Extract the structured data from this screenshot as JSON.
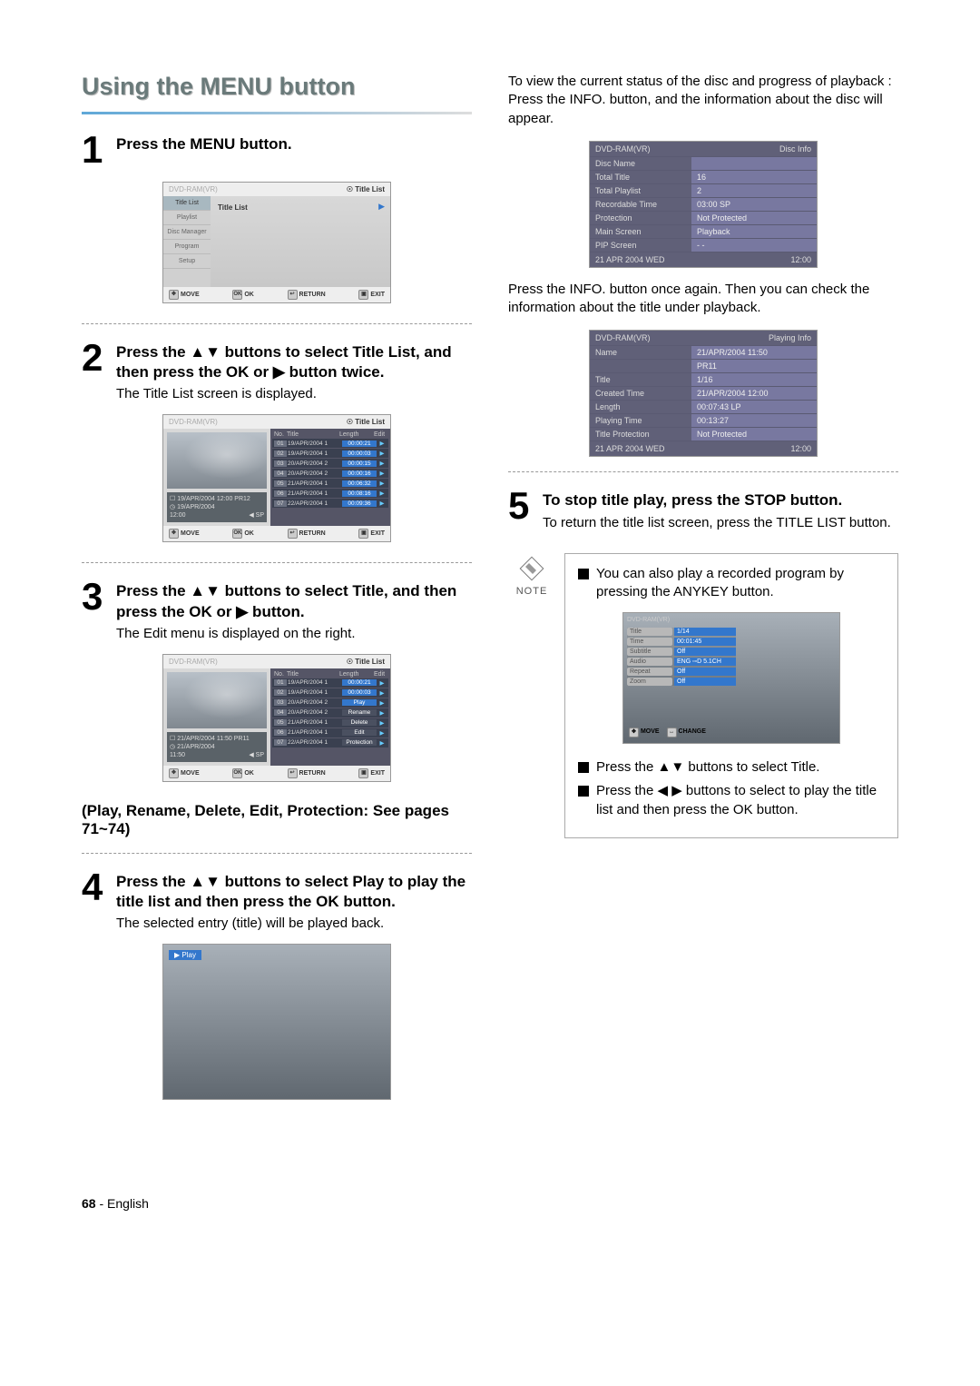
{
  "section_title": "Using the MENU button",
  "step1": {
    "title": "Press the MENU button.",
    "screen": {
      "brand": "DVD-RAM(VR)",
      "head_right": "Title List",
      "sidebar": [
        "Title List",
        "Playlist",
        "Disc Manager",
        "Program",
        "Setup"
      ],
      "content_label": "Title List",
      "foot": [
        "MOVE",
        "OK",
        "RETURN",
        "EXIT"
      ]
    }
  },
  "step2": {
    "title": "Press the ▲▼ buttons to select Title List, and then press the OK or ▶ button twice.",
    "desc": "The Title List screen is displayed.",
    "screen": {
      "brand": "DVD-RAM(VR)",
      "head_right": "Title List",
      "preview_meta_line1": "19/APR/2004 12:00 PR12",
      "preview_meta_line2": "19/APR/2004",
      "preview_meta_line3": "12:00",
      "preview_meta_sp": "SP",
      "list_head": [
        "No.",
        "Title",
        "Length",
        "Edit"
      ],
      "rows": [
        {
          "no": "01",
          "title": "19/APR/2004 1",
          "len": "00:00:21"
        },
        {
          "no": "02",
          "title": "19/APR/2004 1",
          "len": "00:00:03"
        },
        {
          "no": "03",
          "title": "20/APR/2004 2",
          "len": "00:00:15"
        },
        {
          "no": "04",
          "title": "20/APR/2004 2",
          "len": "00:00:16"
        },
        {
          "no": "05",
          "title": "21/APR/2004 1",
          "len": "00:06:32"
        },
        {
          "no": "06",
          "title": "21/APR/2004 1",
          "len": "00:08:16"
        },
        {
          "no": "07",
          "title": "22/APR/2004 1",
          "len": "00:09:36"
        }
      ],
      "foot": [
        "MOVE",
        "OK",
        "RETURN",
        "EXIT"
      ]
    }
  },
  "step3": {
    "title": "Press the ▲▼ buttons to select Title, and then press the OK or ▶ button.",
    "desc": "The Edit menu is displayed on the right.",
    "screen": {
      "brand": "DVD-RAM(VR)",
      "head_right": "Title List",
      "preview_meta_line1": "21/APR/2004 11:50 PR11",
      "preview_meta_line2": "21/APR/2004",
      "preview_meta_line3": "11:50",
      "preview_meta_sp": "SP",
      "list_head": [
        "No.",
        "Title",
        "Length",
        "Edit"
      ],
      "rows": [
        {
          "no": "01",
          "title": "19/APR/2004 1",
          "len": "00:00:21"
        },
        {
          "no": "02",
          "title": "19/APR/2004 1",
          "len": "00:00:03"
        },
        {
          "no": "03",
          "title": "20/APR/2004 2",
          "len": "Play",
          "cls": "highlight"
        },
        {
          "no": "04",
          "title": "20/APR/2004 2",
          "len": "Rename",
          "cls": "edit"
        },
        {
          "no": "05",
          "title": "21/APR/2004 1",
          "len": "Delete",
          "cls": "edit"
        },
        {
          "no": "06",
          "title": "21/APR/2004 1",
          "len": "Edit",
          "cls": "edit"
        },
        {
          "no": "07",
          "title": "22/APR/2004 1",
          "len": "Protection",
          "cls": "edit"
        }
      ],
      "foot": [
        "MOVE",
        "OK",
        "RETURN",
        "EXIT"
      ]
    }
  },
  "sub_bold": "(Play, Rename, Delete, Edit, Protection: See pages 71~74)",
  "step4": {
    "title": "Press the ▲▼ buttons to select Play to play the title list and then press the OK button.",
    "desc": "The selected entry (title) will be played back.",
    "play_label": "▶  Play"
  },
  "right_intro": "To view the current status of the disc and progress of playback : Press the INFO. button, and the information about the disc will appear.",
  "disc_info": {
    "brand": "DVD-RAM(VR)",
    "head_right": "Disc Info",
    "rows": [
      {
        "k": "Disc Name",
        "v": ""
      },
      {
        "k": "Total Title",
        "v": "16"
      },
      {
        "k": "Total Playlist",
        "v": "2"
      },
      {
        "k": "Recordable Time",
        "v": "03:00 SP"
      },
      {
        "k": "Protection",
        "v": "Not Protected"
      },
      {
        "k": "Main Screen",
        "v": "Playback"
      },
      {
        "k": "PIP Screen",
        "v": "- -"
      }
    ],
    "foot_left": "21 APR 2004 WED",
    "foot_right": "12:00"
  },
  "right_mid": "Press the INFO. button once again. Then you can check the information about the title under playback.",
  "playing_info": {
    "brand": "DVD-RAM(VR)",
    "head_right": "Playing Info",
    "rows": [
      {
        "k": "Name",
        "v": "21/APR/2004 11:50"
      },
      {
        "k": "",
        "v": "PR11"
      },
      {
        "k": "Title",
        "v": "1/16"
      },
      {
        "k": "Created Time",
        "v": "21/APR/2004 12:00"
      },
      {
        "k": "Length",
        "v": "00:07:43 LP"
      },
      {
        "k": "Playing Time",
        "v": "00:13:27"
      },
      {
        "k": "Title Protection",
        "v": "Not Protected"
      }
    ],
    "foot_left": "21 APR 2004 WED",
    "foot_right": "12:00"
  },
  "step5": {
    "title": "To stop title play, press the STOP button.",
    "desc": "To return the title list screen, press the TITLE LIST button."
  },
  "note": {
    "label": "NOTE",
    "bullet1": "You can also play a recorded program by pressing the ANYKEY button.",
    "anykey": {
      "brand": "DVD-RAM(VR)",
      "rows": [
        {
          "k": "Title",
          "v": "1/14"
        },
        {
          "k": "Time",
          "v": "00:01:45"
        },
        {
          "k": "Subtitle",
          "v": "Off"
        },
        {
          "k": "Audio",
          "v": "ENG ▫▫D  5.1CH"
        },
        {
          "k": "Repeat",
          "v": "Off"
        },
        {
          "k": "Zoom",
          "v": "Off"
        }
      ],
      "foot": [
        "MOVE",
        "CHANGE"
      ]
    },
    "bullet2": "Press the ▲▼ buttons to select Title.",
    "bullet3": "Press the ◀ ▶ buttons to select to play the title list and then press the OK button."
  },
  "page_num": "68",
  "page_lang": "English"
}
